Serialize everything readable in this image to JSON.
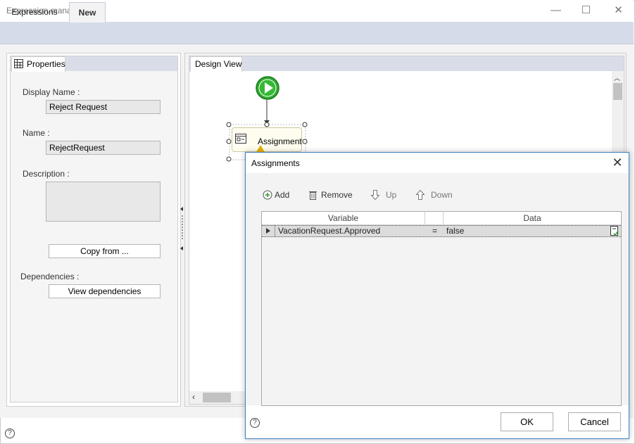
{
  "window": {
    "title": "Expression manager",
    "minimize": "—",
    "maximize": "☐",
    "close": "✕"
  },
  "tabs": [
    {
      "label": "Expressions"
    },
    {
      "label": "New"
    }
  ],
  "properties": {
    "tab_label": "Properties",
    "display_name_label": "Display Name :",
    "display_name_value": "Reject Request",
    "name_label": "Name :",
    "name_value": "RejectRequest",
    "description_label": "Description :",
    "description_value": "",
    "copy_from": "Copy from ...",
    "dependencies_label": "Dependencies :",
    "view_dependencies": "View dependencies"
  },
  "design_view": {
    "tab_label": "Design View",
    "node_label": "Assignment"
  },
  "dialog": {
    "title": "Assignments",
    "close": "✕",
    "toolbar": {
      "add": "Add",
      "remove": "Remove",
      "up": "Up",
      "down": "Down"
    },
    "columns": {
      "variable": "Variable",
      "data": "Data"
    },
    "rows": [
      {
        "variable": "VacationRequest.Approved",
        "operator": "=",
        "data": "false"
      }
    ],
    "ok": "OK",
    "cancel": "Cancel",
    "help": "?"
  },
  "footer": {
    "help": "?"
  },
  "icons": {
    "minimize": "minimize-icon",
    "maximize": "maximize-icon",
    "close": "close-icon",
    "properties": "properties-grid-icon",
    "start": "start-play-icon",
    "assignment": "assignment-icon",
    "warning": "warning-icon",
    "add": "add-circle-icon",
    "remove": "trash-icon",
    "up": "arrow-up-icon",
    "down": "arrow-down-icon",
    "expand": "row-expand-icon",
    "edit": "edit-document-icon"
  },
  "colors": {
    "tabstrip": "#d6dbe9",
    "start_green": "#2eaa2e",
    "dialog_border": "#3d7fc4",
    "warning": "#e8b000"
  }
}
